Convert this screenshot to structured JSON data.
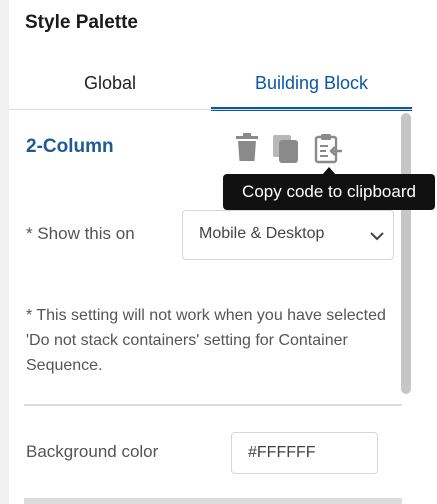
{
  "panel": {
    "title": "Style Palette"
  },
  "tabs": [
    {
      "label": "Global",
      "active": false
    },
    {
      "label": "Building Block",
      "active": true
    }
  ],
  "block": {
    "name": "2-Column",
    "actions": [
      {
        "name": "trash-icon"
      },
      {
        "name": "copy-icon"
      },
      {
        "name": "clipboard-code-icon"
      }
    ]
  },
  "tooltip": {
    "text": "Copy code to clipboard"
  },
  "show_on": {
    "label": "* Show this on",
    "selected": "Mobile & Desktop"
  },
  "note": "* This setting will not work when you have selected 'Do not stack containers' setting for Container Sequence.",
  "background": {
    "label": "Background color",
    "value": "#FFFFFF"
  },
  "colors": {
    "accent": "#0b57a4",
    "block_name": "#1e5a94",
    "icon_gray": "#8a8a8a",
    "tooltip_bg": "#111111"
  }
}
